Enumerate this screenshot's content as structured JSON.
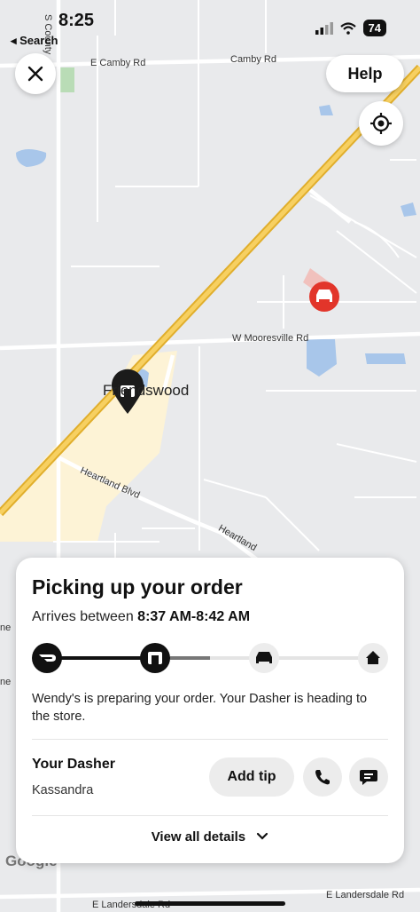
{
  "status_bar": {
    "time": "8:25",
    "back_label": "◂ Search",
    "battery": "74"
  },
  "top_controls": {
    "help_label": "Help"
  },
  "map": {
    "roads": [
      "E Camby Rd",
      "Camby Rd",
      "W Mooresville Rd",
      "Heartland Blvd",
      "Heartland",
      "E Landersdale Rd",
      "E Landersdale Rd",
      "S County",
      "ne",
      "ne"
    ],
    "town": "Friendswood",
    "attribution": "Google"
  },
  "order_card": {
    "title": "Picking up your order",
    "arrives_prefix": "Arrives between",
    "arrives_window": "8:37 AM-8:42 AM",
    "description": "Wendy's is preparing your order. Your Dasher is heading to the store.",
    "dasher_heading": "Your Dasher",
    "dasher_name": "Kassandra",
    "add_tip_label": "Add tip",
    "view_details_label": "View all details",
    "progress_stage": 2,
    "progress_total": 4
  },
  "colors": {
    "brand_red": "#e2352a",
    "highway": "#f4c343",
    "water": "#a8c6ea",
    "park": "#fdf3d6"
  }
}
